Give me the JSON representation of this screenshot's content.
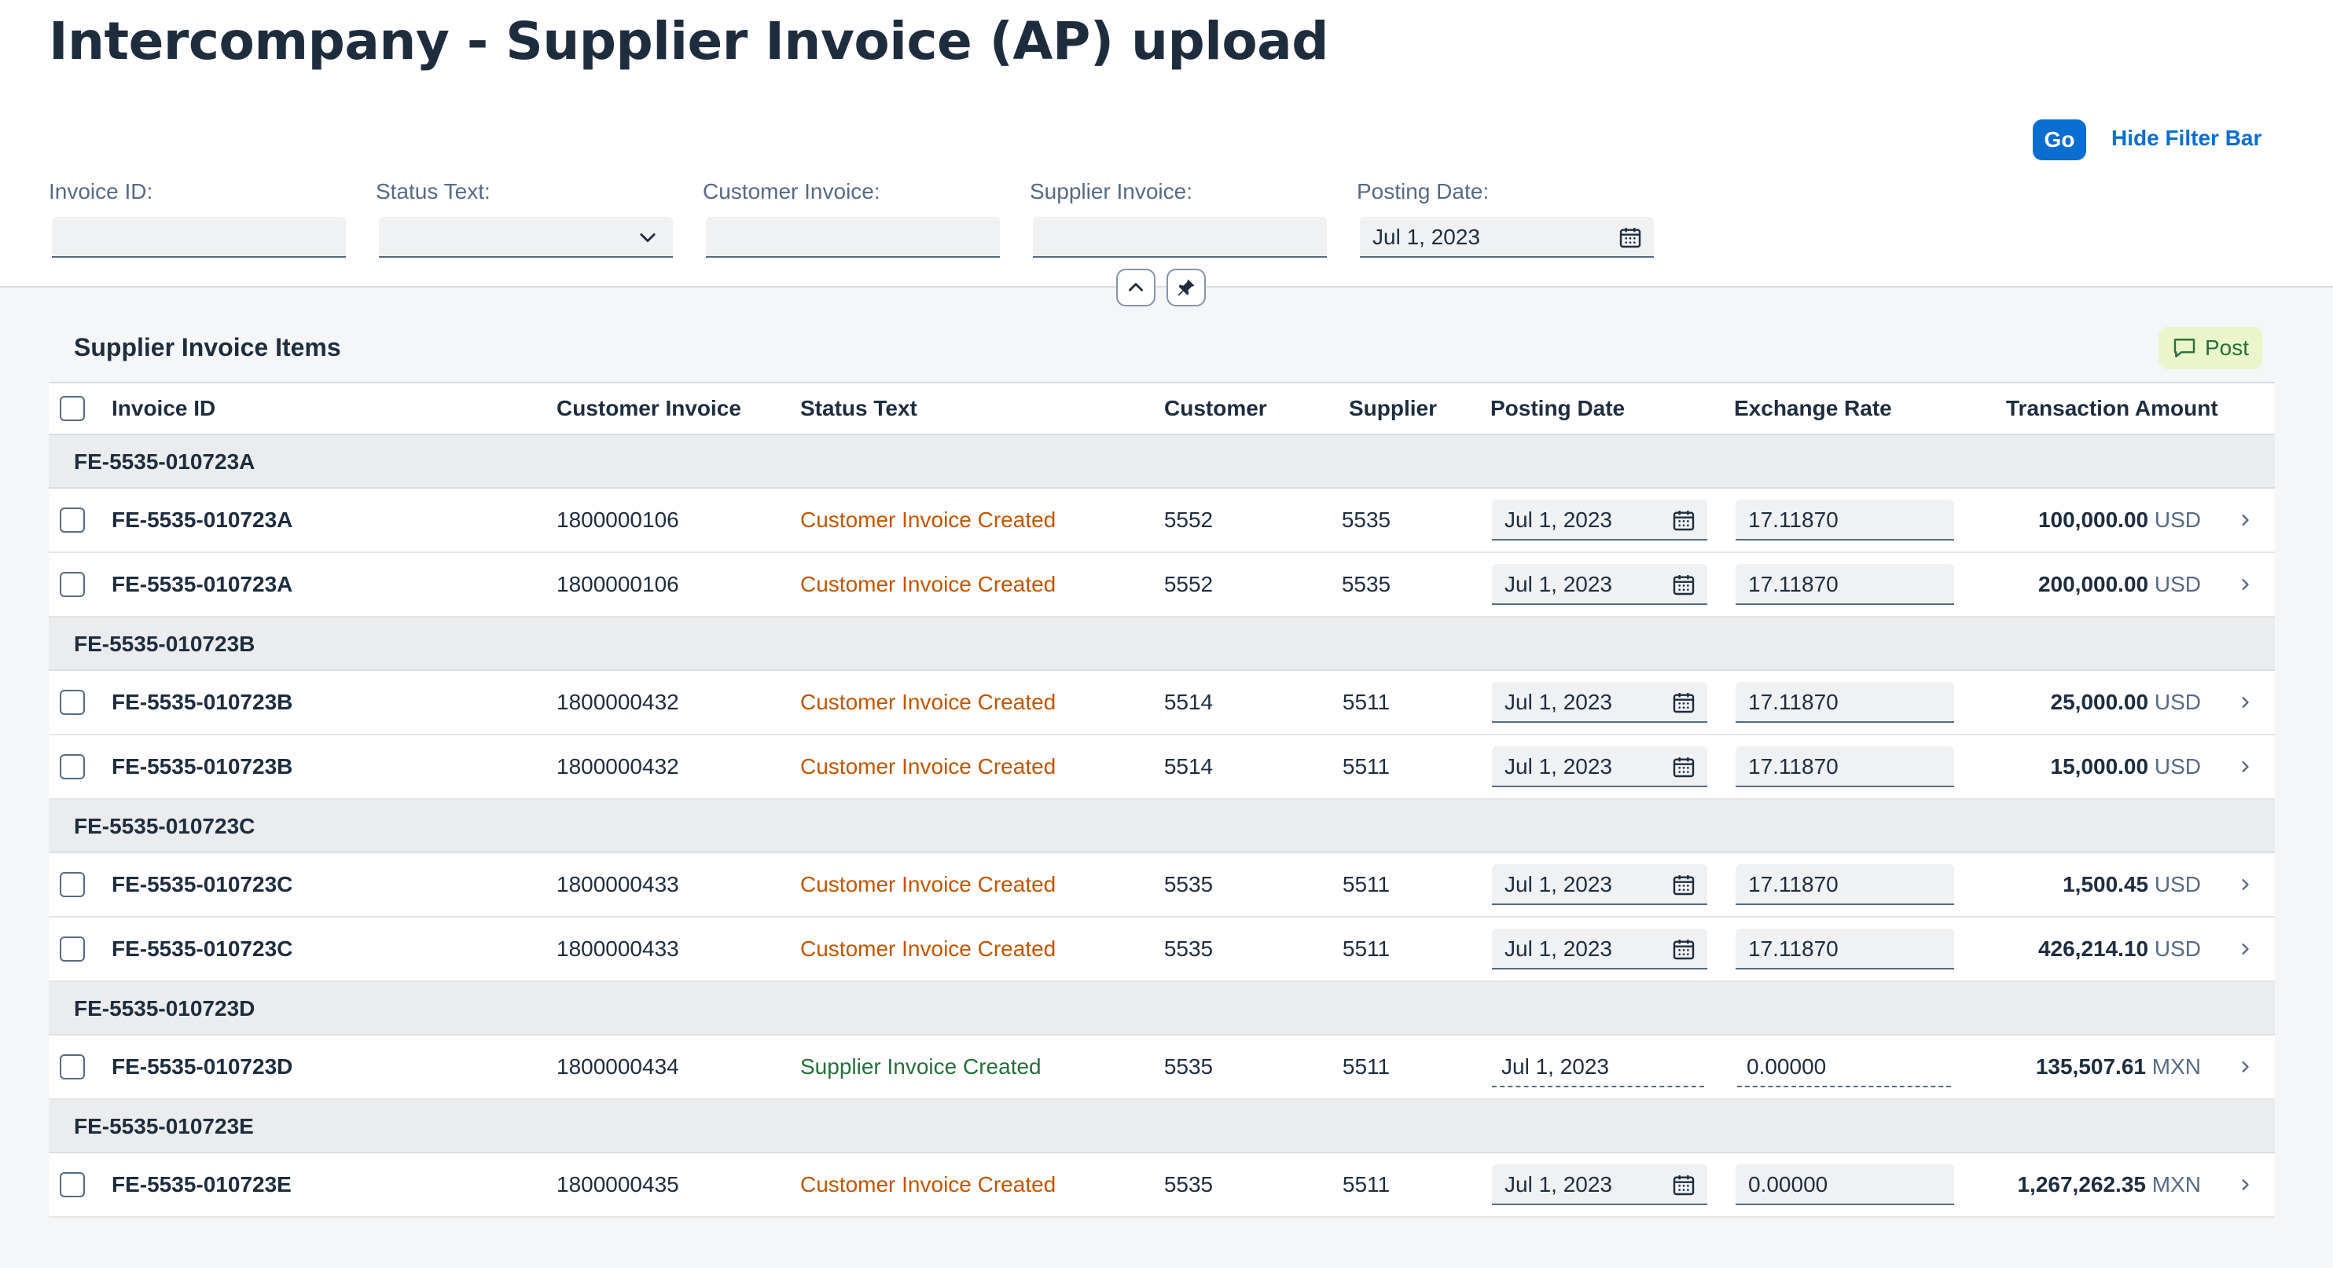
{
  "page": {
    "title": "Intercompany - Supplier Invoice (AP) upload"
  },
  "filter_bar": {
    "go_label": "Go",
    "hide_label": "Hide Filter Bar",
    "fields": [
      {
        "label": "Invoice ID:",
        "value": ""
      },
      {
        "label": "Status Text:",
        "value": ""
      },
      {
        "label": "Customer Invoice:",
        "value": ""
      },
      {
        "label": "Supplier Invoice:",
        "value": ""
      },
      {
        "label": "Posting Date:",
        "value": "Jul 1, 2023"
      }
    ]
  },
  "table": {
    "title": "Supplier Invoice Items",
    "post_label": "Post",
    "columns": [
      "Invoice ID",
      "Customer Invoice",
      "Status Text",
      "Customer",
      "Supplier",
      "Posting Date",
      "Exchange Rate",
      "Transaction Amount"
    ],
    "groups": [
      {
        "title": "FE-5535-010723A",
        "rows": [
          {
            "invoice_id": "FE-5535-010723A",
            "customer_invoice": "1800000106",
            "status": "Customer Invoice Created",
            "customer": "5552",
            "supplier": "5535",
            "posting_date": "Jul 1, 2023",
            "exchange_rate": "17.11870",
            "amount": "100,000.00",
            "currency": "USD"
          },
          {
            "invoice_id": "FE-5535-010723A",
            "customer_invoice": "1800000106",
            "status": "Customer Invoice Created",
            "customer": "5552",
            "supplier": "5535",
            "posting_date": "Jul 1, 2023",
            "exchange_rate": "17.11870",
            "amount": "200,000.00",
            "currency": "USD"
          }
        ]
      },
      {
        "title": "FE-5535-010723B",
        "rows": [
          {
            "invoice_id": "FE-5535-010723B",
            "customer_invoice": "1800000432",
            "status": "Customer Invoice Created",
            "customer": "5514",
            "supplier": "5511",
            "posting_date": "Jul 1, 2023",
            "exchange_rate": "17.11870",
            "amount": "25,000.00",
            "currency": "USD"
          },
          {
            "invoice_id": "FE-5535-010723B",
            "customer_invoice": "1800000432",
            "status": "Customer Invoice Created",
            "customer": "5514",
            "supplier": "5511",
            "posting_date": "Jul 1, 2023",
            "exchange_rate": "17.11870",
            "amount": "15,000.00",
            "currency": "USD"
          }
        ]
      },
      {
        "title": "FE-5535-010723C",
        "rows": [
          {
            "invoice_id": "FE-5535-010723C",
            "customer_invoice": "1800000433",
            "status": "Customer Invoice Created",
            "customer": "5535",
            "supplier": "5511",
            "posting_date": "Jul 1, 2023",
            "exchange_rate": "17.11870",
            "amount": "1,500.45",
            "currency": "USD"
          },
          {
            "invoice_id": "FE-5535-010723C",
            "customer_invoice": "1800000433",
            "status": "Customer Invoice Created",
            "customer": "5535",
            "supplier": "5511",
            "posting_date": "Jul 1, 2023",
            "exchange_rate": "17.11870",
            "amount": "426,214.10",
            "currency": "USD"
          }
        ]
      },
      {
        "title": "FE-5535-010723D",
        "rows": [
          {
            "invoice_id": "FE-5535-010723D",
            "customer_invoice": "1800000434",
            "status": "Supplier Invoice Created",
            "customer": "5535",
            "supplier": "5511",
            "posting_date": "Jul 1, 2023",
            "exchange_rate": "0.00000",
            "amount": "135,507.61",
            "currency": "MXN",
            "readonly": true
          }
        ]
      },
      {
        "title": "FE-5535-010723E",
        "rows": [
          {
            "invoice_id": "FE-5535-010723E",
            "customer_invoice": "1800000435",
            "status": "Customer Invoice Created",
            "customer": "5535",
            "supplier": "5511",
            "posting_date": "Jul 1, 2023",
            "exchange_rate": "0.00000",
            "amount": "1,267,262.35",
            "currency": "MXN"
          }
        ]
      }
    ]
  },
  "colors": {
    "accent": "#0a6ed1",
    "status_customer_created": "#c35500",
    "status_supplier_created": "#256f3a"
  },
  "icons": {
    "dropdown": "chevron-down-icon",
    "calendar": "calendar-icon",
    "collapse": "chevron-up-icon",
    "pin": "pin-icon",
    "post": "comment-icon",
    "row_nav": "chevron-right-icon"
  }
}
